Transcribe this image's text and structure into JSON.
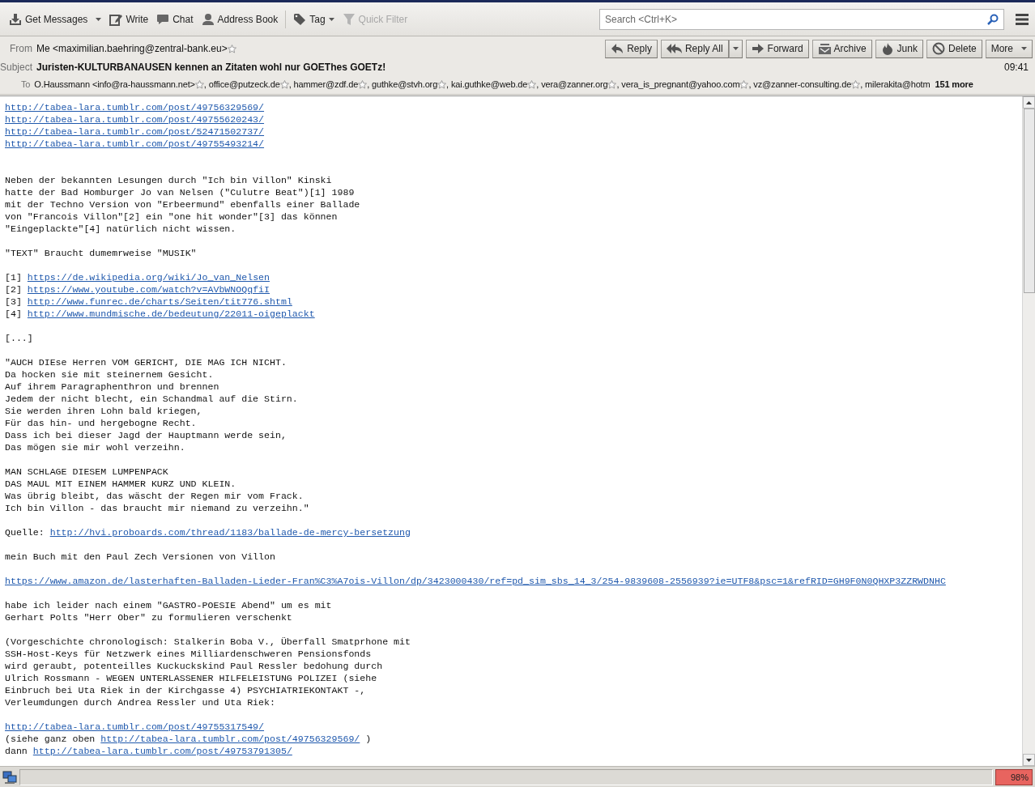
{
  "toolbar": {
    "buttons": [
      {
        "label": "Get Messages",
        "kind": "split",
        "disabled": false
      },
      {
        "label": "Write",
        "kind": "plain",
        "disabled": false
      },
      {
        "label": "Chat",
        "kind": "plain",
        "disabled": false
      },
      {
        "label": "Address Book",
        "kind": "plain",
        "disabled": false
      },
      {
        "label": "Tag",
        "kind": "dropdown",
        "disabled": false
      },
      {
        "label": "Quick Filter",
        "kind": "plain",
        "disabled": true
      }
    ],
    "search": {
      "placeholder": "Search <Ctrl+K>"
    }
  },
  "header": {
    "from": {
      "label": "From",
      "value": "Me <maximilian.baehring@zentral-bank.eu>"
    },
    "actions": [
      {
        "label": "Reply",
        "kind": "plain"
      },
      {
        "label": "Reply All",
        "kind": "split"
      },
      {
        "label": "Forward",
        "kind": "plain"
      },
      {
        "label": "Archive",
        "kind": "plain"
      },
      {
        "label": "Junk",
        "kind": "plain"
      },
      {
        "label": "Delete",
        "kind": "plain"
      },
      {
        "label": "More",
        "kind": "dropdown"
      }
    ],
    "subject": {
      "label": "Subject",
      "value": "Juristen-KULTURBANAUSEN kennen an Zitaten wohl nur GOEThes GOETz!"
    },
    "time": "09:41",
    "to": {
      "label": "To",
      "separator": ",",
      "recipients": [
        "O.Haussmann <info@ra-haussmann.net>",
        "office@putzeck.de",
        "hammer@zdf.de",
        "guthke@stvh.org",
        "kai.guthke@web.de",
        "vera@zanner.org",
        "vera_is_pregnant@yahoo.com",
        "vz@zanner-consulting.de",
        "milerakita@hotm"
      ],
      "more": "151 more"
    }
  },
  "body": {
    "paragraphs": [
      {
        "lines": [
          [
            {
              "kind": "link",
              "text": "http://tabea-lara.tumblr.com/post/49756329569/"
            }
          ],
          [
            {
              "kind": "link",
              "text": "http://tabea-lara.tumblr.com/post/49755620243/"
            }
          ],
          [
            {
              "kind": "link",
              "text": "http://tabea-lara.tumblr.com/post/52471502737/"
            }
          ],
          [
            {
              "kind": "link",
              "text": "http://tabea-lara.tumblr.com/post/49755493214/"
            }
          ]
        ]
      },
      {
        "lines": [
          [
            {
              "kind": "text",
              "text": "Neben der bekannten Lesungen durch \"Ich bin Villon\" Kinski"
            }
          ],
          [
            {
              "kind": "text",
              "text": "hatte der Bad Homburger Jo van Nelsen (\"Culutre Beat\")[1] 1989"
            }
          ],
          [
            {
              "kind": "text",
              "text": "mit der Techno Version von \"Erbeermund\" ebenfalls einer Ballade"
            }
          ],
          [
            {
              "kind": "text",
              "text": "von \"Francois Villon\"[2] ein \"one hit wonder\"[3] das können"
            }
          ],
          [
            {
              "kind": "text",
              "text": "\"Eingeplackte\"[4] natürlich nicht wissen."
            }
          ]
        ]
      },
      {
        "lines": [
          [
            {
              "kind": "text",
              "text": "\"TEXT\" Braucht dumemrweise \"MUSIK\""
            }
          ]
        ]
      },
      {
        "lines": [
          [
            {
              "kind": "text",
              "text": "[1] "
            },
            {
              "kind": "link",
              "text": "https://de.wikipedia.org/wiki/Jo_van_Nelsen"
            }
          ],
          [
            {
              "kind": "text",
              "text": "[2] "
            },
            {
              "kind": "link",
              "text": "https://www.youtube.com/watch?v=AVbWNOQqfiI"
            }
          ],
          [
            {
              "kind": "text",
              "text": "[3] "
            },
            {
              "kind": "link",
              "text": "http://www.funrec.de/charts/Seiten/tit776.shtml"
            }
          ],
          [
            {
              "kind": "text",
              "text": "[4] "
            },
            {
              "kind": "link",
              "text": "http://www.mundmische.de/bedeutung/22011-oigeplackt"
            }
          ]
        ]
      },
      {
        "lines": [
          [
            {
              "kind": "text",
              "text": "[...]"
            }
          ]
        ]
      },
      {
        "lines": [
          [
            {
              "kind": "text",
              "text": "\"AUCH DIEse Herren VOM GERICHT, DIE MAG ICH NICHT."
            }
          ],
          [
            {
              "kind": "text",
              "text": "Da hocken sie mit steinernem Gesicht."
            }
          ],
          [
            {
              "kind": "text",
              "text": "Auf ihrem Paragraphenthron und brennen"
            }
          ],
          [
            {
              "kind": "text",
              "text": "Jedem der nicht blecht, ein Schandmal auf die Stirn."
            }
          ],
          [
            {
              "kind": "text",
              "text": "Sie werden ihren Lohn bald kriegen,"
            }
          ],
          [
            {
              "kind": "text",
              "text": "Für das hin- und hergebogne Recht."
            }
          ],
          [
            {
              "kind": "text",
              "text": "Dass ich bei dieser Jagd der Hauptmann werde sein,"
            }
          ],
          [
            {
              "kind": "text",
              "text": "Das mögen sie mir wohl verzeihn."
            }
          ]
        ]
      },
      {
        "lines": [
          [
            {
              "kind": "text",
              "text": "MAN SCHLAGE DIESEM LUMPENPACK"
            }
          ],
          [
            {
              "kind": "text",
              "text": "DAS MAUL MIT EINEM HAMMER KURZ UND KLEIN."
            }
          ],
          [
            {
              "kind": "text",
              "text": "Was übrig bleibt, das wäscht der Regen mir vom Frack."
            }
          ],
          [
            {
              "kind": "text",
              "text": "Ich bin Villon - das braucht mir niemand zu verzeihn.\""
            }
          ]
        ]
      },
      {
        "lines": [
          [
            {
              "kind": "text",
              "text": "Quelle: "
            },
            {
              "kind": "link",
              "text": "http://hvi.proboards.com/thread/1183/ballade-de-mercy-bersetzung"
            }
          ]
        ]
      },
      {
        "lines": [
          [
            {
              "kind": "text",
              "text": "mein Buch mit den Paul Zech Versionen von Villon"
            }
          ]
        ]
      },
      {
        "lines": [
          [
            {
              "kind": "link",
              "text": "https://www.amazon.de/lasterhaften-Balladen-Lieder-Fran%C3%A7ois-Villon/dp/3423000430/ref=pd_sim_sbs_14_3/254-9839608-2556939?ie=UTF8&psc=1&refRID=GH9F0N0QHXP3ZZRWDNHC"
            }
          ]
        ]
      },
      {
        "lines": [
          [
            {
              "kind": "text",
              "text": "habe ich leider nach einem \"GASTRO-POESIE Abend\" um es mit"
            }
          ],
          [
            {
              "kind": "text",
              "text": "Gerhart Polts \"Herr Ober\" zu formulieren verschenkt"
            }
          ]
        ]
      },
      {
        "lines": [
          [
            {
              "kind": "text",
              "text": "(Vorgeschichte chronologisch: Stalkerin Boba V., Überfall Smatprhone mit"
            }
          ],
          [
            {
              "kind": "text",
              "text": "SSH-Host-Keys für Netzwerk eines Milliardenschweren Pensionsfonds"
            }
          ],
          [
            {
              "kind": "text",
              "text": "wird geraubt, potenteilles Kuckuckskind Paul Ressler bedohung durch"
            }
          ],
          [
            {
              "kind": "text",
              "text": "Ulrich Rossmann - WEGEN UNTERLASSENER HILFELEISTUNG POLIZEI (siehe"
            }
          ],
          [
            {
              "kind": "text",
              "text": "Einbruch bei Uta Riek in der Kirchgasse 4) PSYCHIATRIEKONTAKT -,"
            }
          ],
          [
            {
              "kind": "text",
              "text": "Verleumdungen durch Andrea Ressler und Uta Riek:"
            }
          ]
        ]
      },
      {
        "lines": [
          [
            {
              "kind": "link",
              "text": "http://tabea-lara.tumblr.com/post/49755317549/"
            }
          ],
          [
            {
              "kind": "text",
              "text": "(siehe ganz oben "
            },
            {
              "kind": "link",
              "text": "http://tabea-lara.tumblr.com/post/49756329569/"
            },
            {
              "kind": "text",
              "text": " )"
            }
          ],
          [
            {
              "kind": "text",
              "text": "dann "
            },
            {
              "kind": "link",
              "text": "http://tabea-lara.tumblr.com/post/49753791305/"
            }
          ]
        ]
      }
    ]
  },
  "status_bar": {
    "zoom": "98%"
  }
}
